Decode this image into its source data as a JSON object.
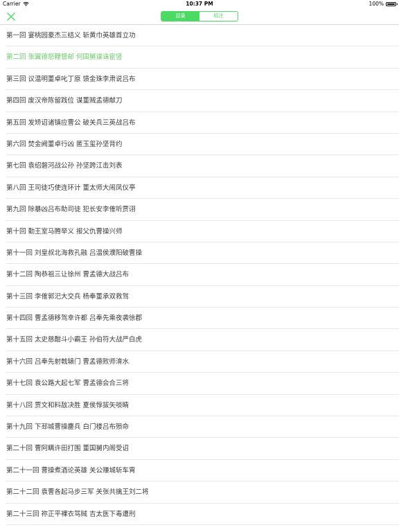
{
  "status_bar": {
    "carrier": "Carrier",
    "time": "10:37 PM",
    "battery_percent": "100%"
  },
  "nav": {
    "close_icon": "close-icon",
    "tabs": [
      {
        "label": "目录",
        "active": true
      },
      {
        "label": "标注",
        "active": false
      }
    ]
  },
  "colors": {
    "accent": "#4cd964",
    "current_chapter": "#6cc96c",
    "text": "#3a3a3a",
    "divider": "#e6e6e6"
  },
  "chapters": [
    {
      "title": "第一回 宴桃园豪杰三结义 斩黄巾英雄首立功",
      "current": false
    },
    {
      "title": "第二回 张翼德怒鞭督邮 何国舅谋诛宦竖",
      "current": true
    },
    {
      "title": "第三回 议温明董卓叱丁原 馈金珠李肃说吕布",
      "current": false
    },
    {
      "title": "第四回 废汉帝陈留践位 谋董贼孟德献刀",
      "current": false
    },
    {
      "title": "第五回 发矫诏诸镇应曹公 破关兵三英战吕布",
      "current": false
    },
    {
      "title": "第六回 焚金阙董卓行凶 匿玉玺孙坚背约",
      "current": false
    },
    {
      "title": "第七回 袁绍磐河战公孙 孙坚跨江击刘表",
      "current": false
    },
    {
      "title": "第八回 王司徒巧使连环计 董太师大闹凤仪亭",
      "current": false
    },
    {
      "title": "第九回 除暴凶吕布助司徒 犯长安李傕听贾诩",
      "current": false
    },
    {
      "title": "第十回 勤王室马腾举义 报父仇曹操兴师",
      "current": false
    },
    {
      "title": "第十一回 刘皇叔北海救孔融 吕温侯濮阳破曹操",
      "current": false
    },
    {
      "title": "第十二回 陶恭祖三让徐州 曹孟德大战吕布",
      "current": false
    },
    {
      "title": "第十三回 李傕郭汜大交兵 杨奉董承双救驾",
      "current": false
    },
    {
      "title": "第十四回 曹孟德移驾幸许都 吕奉先乘夜袭徐郡",
      "current": false
    },
    {
      "title": "第十五回 太史慈酣斗小霸王 孙伯符大战严白虎",
      "current": false
    },
    {
      "title": "第十六回 吕奉先射戟辕门 曹孟德败师淯水",
      "current": false
    },
    {
      "title": "第十七回 袁公路大起七军 曹孟德会合三将",
      "current": false
    },
    {
      "title": "第十八回 贾文和料敌决胜 夏侯惇拔矢啖睛",
      "current": false
    },
    {
      "title": "第十九回 下邳城曹操鏖兵 白门楼吕布殒命",
      "current": false
    },
    {
      "title": "第二十回 曹阿瞒许田打围 董国舅内阁受诏",
      "current": false
    },
    {
      "title": "第二十一回 曹操煮酒论英雄 关公赚城斩车胄",
      "current": false
    },
    {
      "title": "第二十二回 袁曹各起马步三军 关张共擒王刘二将",
      "current": false
    },
    {
      "title": "第二十三回 祢正平裸衣骂贼 吉太医下毒遭刑",
      "current": false
    }
  ]
}
